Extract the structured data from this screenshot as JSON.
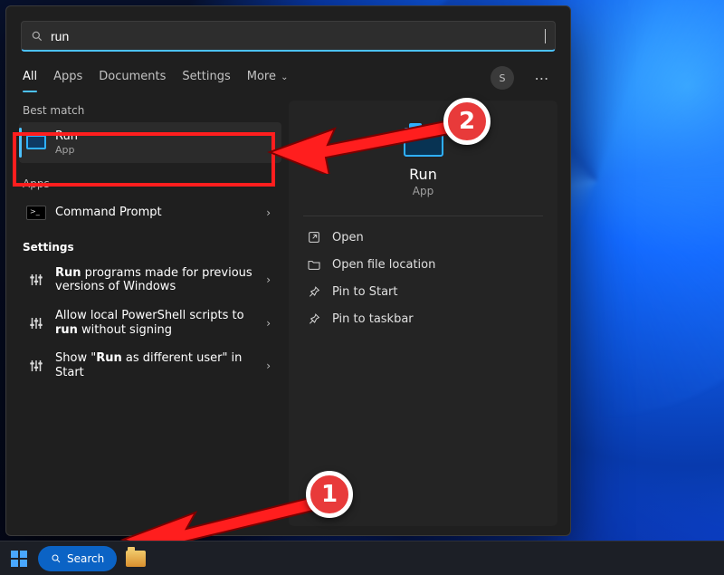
{
  "search": {
    "query": "run"
  },
  "tabs": [
    "All",
    "Apps",
    "Documents",
    "Settings",
    "More"
  ],
  "avatar_initial": "S",
  "left": {
    "best_match_label": "Best match",
    "best": {
      "title": "Run",
      "subtitle": "App"
    },
    "apps_label": "Apps",
    "apps": [
      {
        "title": "Command Prompt"
      }
    ],
    "settings_label": "Settings",
    "settings": [
      {
        "title_pre": "",
        "bold": "Run",
        "title_post": " programs made for previous versions of Windows"
      },
      {
        "title_pre": "Allow local PowerShell scripts to ",
        "bold": "run",
        "title_post": " without signing"
      },
      {
        "title_pre": "Show \"",
        "bold": "Run",
        "title_post": " as different user\" in Start"
      }
    ]
  },
  "right": {
    "title": "Run",
    "subtitle": "App",
    "actions": [
      "Open",
      "Open file location",
      "Pin to Start",
      "Pin to taskbar"
    ]
  },
  "taskbar": {
    "search_label": "Search"
  },
  "annotations": {
    "badge1": "1",
    "badge2": "2"
  }
}
